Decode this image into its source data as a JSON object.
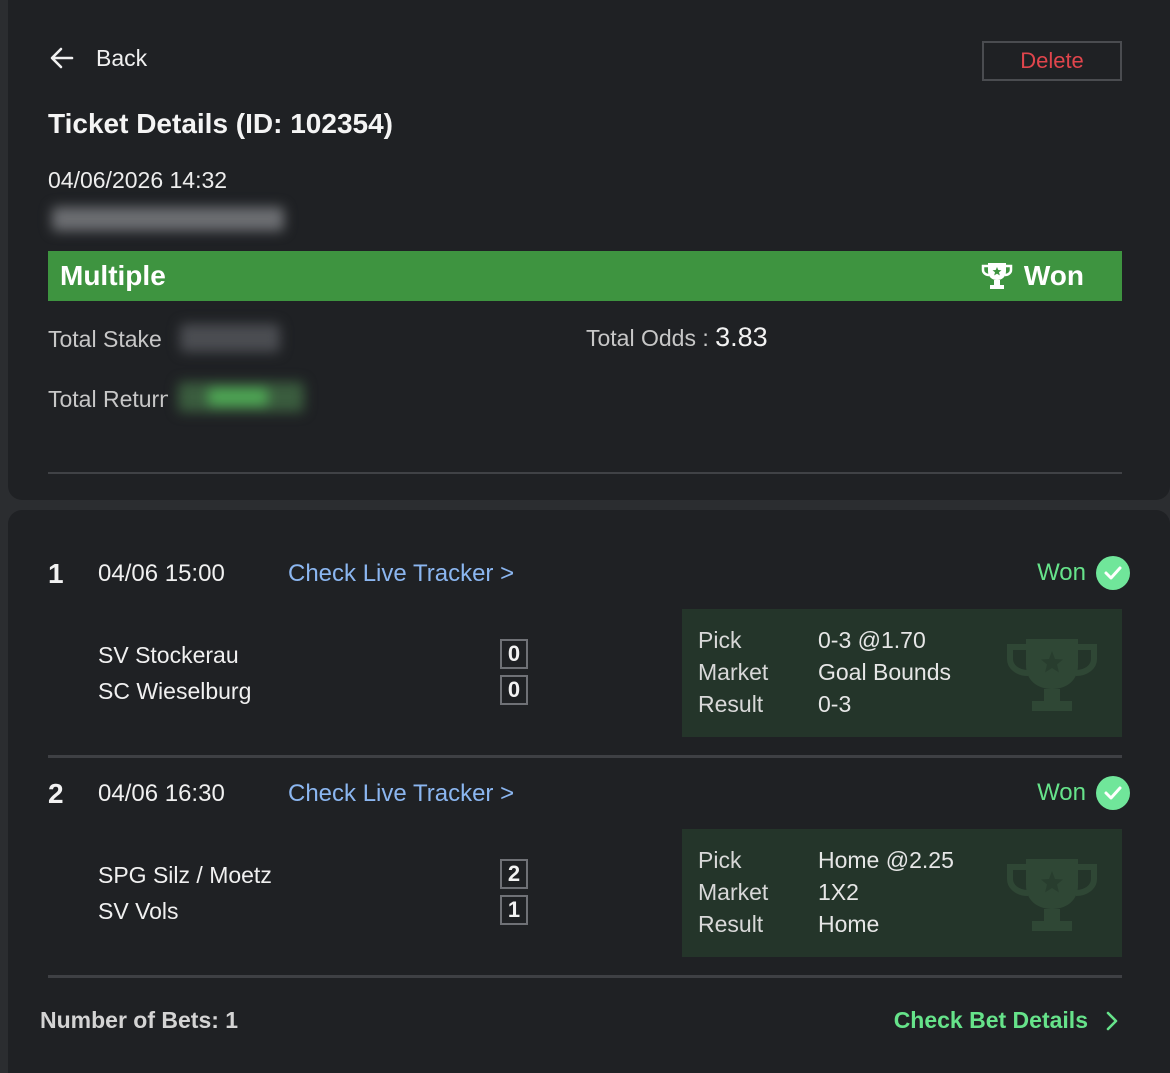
{
  "header": {
    "back_label": "Back",
    "delete_label": "Delete",
    "title": "Ticket Details (ID: 102354)",
    "datetime": "04/06/2026 14:32"
  },
  "banner": {
    "bet_type": "Multiple",
    "status": "Won",
    "color": "#3e9440"
  },
  "summary": {
    "stake_label": "Total Stake",
    "return_label": "Total Return",
    "odds_label": "Total Odds :",
    "odds_value": "3.83"
  },
  "legs": [
    {
      "num": "1",
      "time": "04/06 15:00",
      "tracker_label": "Check Live Tracker >",
      "status": "Won",
      "home_team": "SV Stockerau",
      "away_team": "SC Wieselburg",
      "home_score": "0",
      "away_score": "0",
      "pick_label": "Pick",
      "market_label": "Market",
      "result_label": "Result",
      "pick": "0-3 @1.70",
      "market": "Goal Bounds",
      "result": "0-3"
    },
    {
      "num": "2",
      "time": "04/06 16:30",
      "tracker_label": "Check Live Tracker >",
      "status": "Won",
      "home_team": "SPG Silz / Moetz",
      "away_team": "SV Vols",
      "home_score": "2",
      "away_score": "1",
      "pick_label": "Pick",
      "market_label": "Market",
      "result_label": "Result",
      "pick": "Home @2.25",
      "market": "1X2",
      "result": "Home"
    }
  ],
  "footer": {
    "num_bets": "Number of Bets: 1",
    "details_label": "Check Bet Details"
  },
  "colors": {
    "won_green": "#66e38a",
    "link_blue": "#8bb6f0",
    "delete_red": "#e0454c"
  }
}
